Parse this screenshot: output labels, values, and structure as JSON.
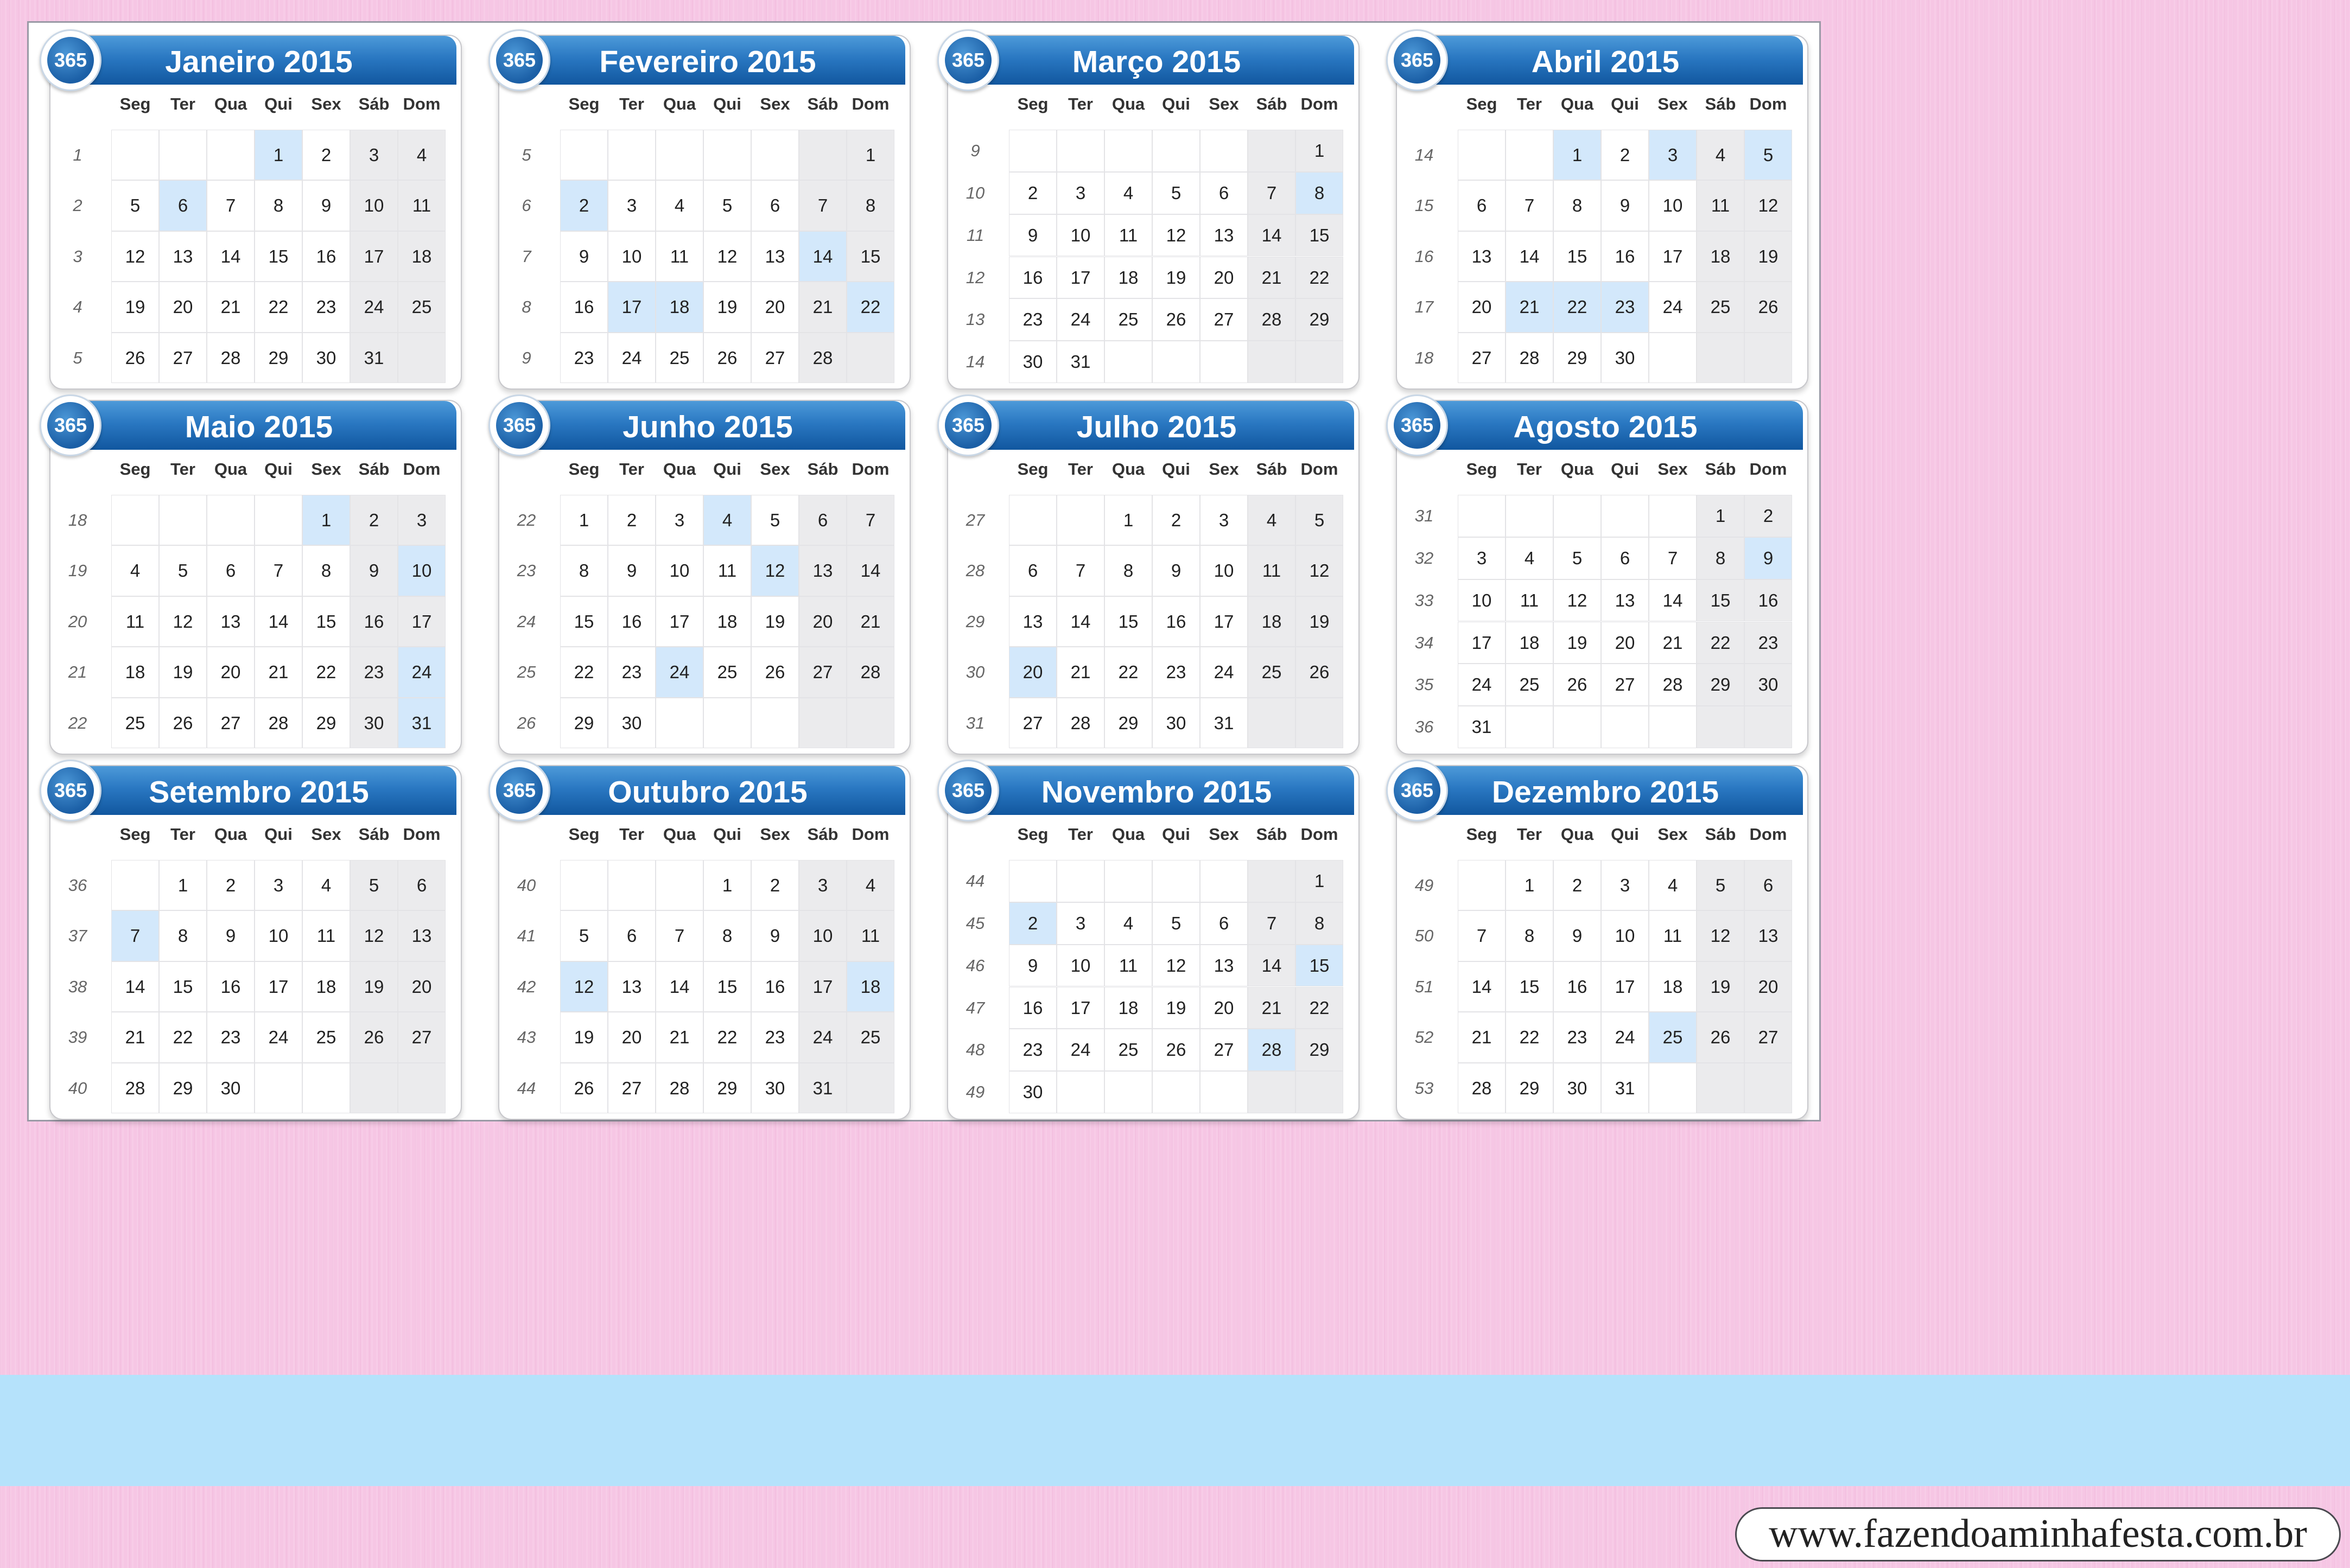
{
  "badge_text": "365",
  "weekday_labels": [
    "Seg",
    "Ter",
    "Qua",
    "Qui",
    "Sex",
    "Sáb",
    "Dom"
  ],
  "footer_url": "www.fazendoaminhafesta.com.br",
  "colors": {
    "header_blue": "#2a78c2",
    "highlight": "#d3e8fb",
    "weekend": "#ebebed",
    "background_pink": "#f6c6e4",
    "band_blue": "#b5e2fb"
  },
  "months": [
    {
      "title": "Janeiro 2015",
      "lead": 3,
      "days": 31,
      "week_start": 1,
      "weeks": 5,
      "highlights": [
        1,
        6
      ]
    },
    {
      "title": "Fevereiro 2015",
      "lead": 6,
      "days": 28,
      "week_start": 5,
      "weeks": 5,
      "highlights": [
        2,
        14,
        17,
        18,
        22
      ]
    },
    {
      "title": "Março 2015",
      "lead": 6,
      "days": 31,
      "week_start": 9,
      "weeks": 6,
      "highlights": [
        8
      ]
    },
    {
      "title": "Abril 2015",
      "lead": 2,
      "days": 30,
      "week_start": 14,
      "weeks": 5,
      "highlights": [
        1,
        3,
        5,
        21,
        22,
        23
      ]
    },
    {
      "title": "Maio 2015",
      "lead": 4,
      "days": 31,
      "week_start": 18,
      "weeks": 5,
      "highlights": [
        1,
        10,
        24,
        31
      ]
    },
    {
      "title": "Junho 2015",
      "lead": 0,
      "days": 30,
      "week_start": 22,
      "weeks": 5,
      "highlights": [
        4,
        12,
        24
      ]
    },
    {
      "title": "Julho 2015",
      "lead": 2,
      "days": 31,
      "week_start": 27,
      "weeks": 5,
      "highlights": [
        20
      ]
    },
    {
      "title": "Agosto 2015",
      "lead": 5,
      "days": 31,
      "week_start": 31,
      "weeks": 6,
      "highlights": [
        9
      ]
    },
    {
      "title": "Setembro 2015",
      "lead": 1,
      "days": 30,
      "week_start": 36,
      "weeks": 5,
      "highlights": [
        7
      ]
    },
    {
      "title": "Outubro 2015",
      "lead": 3,
      "days": 31,
      "week_start": 40,
      "weeks": 5,
      "highlights": [
        12,
        18
      ]
    },
    {
      "title": "Novembro 2015",
      "lead": 6,
      "days": 30,
      "week_start": 44,
      "weeks": 6,
      "highlights": [
        2,
        15,
        28
      ]
    },
    {
      "title": "Dezembro 2015",
      "lead": 1,
      "days": 31,
      "week_start": 49,
      "weeks": 5,
      "highlights": [
        25
      ]
    }
  ]
}
